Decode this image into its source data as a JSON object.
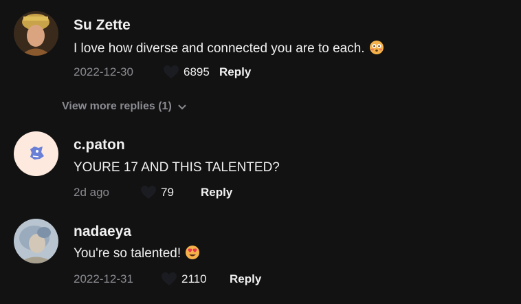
{
  "comments": [
    {
      "author": "Su Zette",
      "text": "I love how diverse and connected you are to each.",
      "emoji": "flushed-face-icon",
      "date": "2022-12-30",
      "likes": "6895",
      "reply_label": "Reply"
    },
    {
      "author": "c.paton",
      "text": "YOURE 17 AND THIS TALENTED?",
      "date": "2d ago",
      "likes": "79",
      "reply_label": "Reply"
    },
    {
      "author": "nadaeya",
      "text": "You're so talented!",
      "emoji": "heart-eyes-face-icon",
      "date": "2022-12-31",
      "likes": "2110",
      "reply_label": "Reply"
    }
  ],
  "view_more_label": "View more replies (1)",
  "colors": {
    "background": "#121212",
    "text": "#f1f1f2",
    "muted": "#8a8b91"
  }
}
